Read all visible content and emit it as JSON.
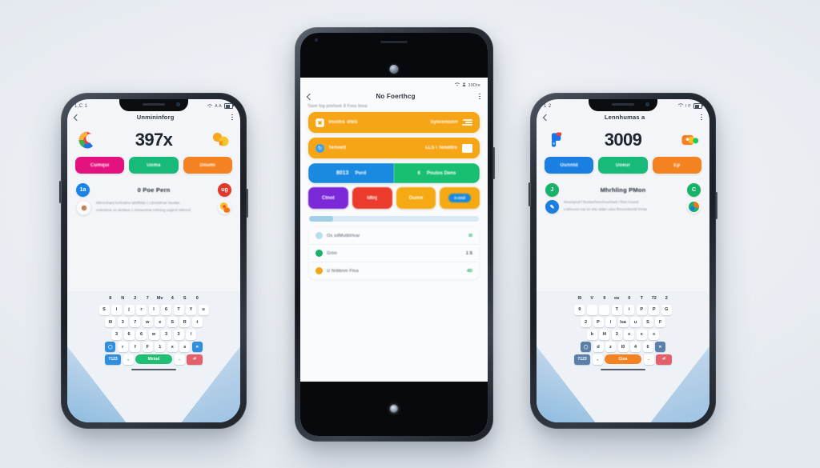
{
  "scene": {
    "background_color": "#eceff4",
    "description": "Three smartphones displayed side by side showing colorful mobile app screens"
  },
  "phones": [
    {
      "id": "left-phone",
      "frame_color": "#2a3039",
      "status_bar": {
        "left": "1,C 1",
        "wifi": "wifi-icon",
        "signal": "A A",
        "battery": "0"
      },
      "app_bar": {
        "back": "back-chevron-icon",
        "title": "Unmininforg",
        "menu": "kebab-menu-icon"
      },
      "hero": {
        "number": "397x",
        "left_glyph": "colorful-c-logo-icon",
        "right_glyph": "orange-cloud-icon"
      },
      "pills": [
        {
          "label": "Cumqui",
          "color": "#e3127f"
        },
        {
          "label": "Uoma",
          "color": "#17ba78"
        },
        {
          "label": "Doumi",
          "color": "#f58220"
        }
      ],
      "row": {
        "left_badge": "1a",
        "left_badge_color": "#1a84e8",
        "title": "0 Poe Pern",
        "right_badge": "ug",
        "right_badge_color": "#e0392b"
      },
      "description": {
        "line1": "Mthorolopul lunhodino tdmfbfab 1 Libontdroar haudan",
        "line2": "Anbnlazar uo denlaun 1 Aimaonima Anhning uoginol vldmnul",
        "left_icon": "avatar-icon",
        "right_icon": "orange-heart-icon"
      },
      "keyboard": {
        "number_row": [
          "8",
          "N",
          "2",
          "7",
          "Mv",
          "4",
          "S",
          "0"
        ],
        "row1": [
          "S",
          "i",
          "j",
          "r",
          "l",
          "6",
          "T",
          "Y",
          "u"
        ],
        "row2": [
          "l0",
          "3",
          "7",
          "w",
          "e",
          "S",
          "R",
          "t"
        ],
        "row3": [
          "3",
          "6",
          "6",
          "w",
          "3",
          "3",
          "/"
        ],
        "row4": [
          "r",
          "f",
          "F",
          "1",
          "x",
          "s"
        ],
        "space_label": "Mxtod",
        "space_color": "#21bf73",
        "left_accent_color": "#2f8ede",
        "right_accent_color": "#e4606a",
        "left_key": "globe-icon",
        "right_key": "delete-icon"
      }
    },
    {
      "id": "center-phone",
      "frame_color": "#1a1d22",
      "status_bar": {
        "wifi": "wifi-icon",
        "person": "person-icon",
        "battery_text": "39Dte"
      },
      "app_bar": {
        "back": "back-chevron-icon",
        "title": "No Foerthcg",
        "menu": "kebab-menu-icon"
      },
      "subline": "Tosm fog pmrlontr 8  Fons bnsa",
      "banners": [
        {
          "label": "Vooths dlbS",
          "right_text": "Synconozirr",
          "color": "#f5a515",
          "icon": "folder-icon",
          "right_icon": "stacked-lines-icon"
        },
        {
          "label": "Tenvett",
          "right_text": "LLS l Tenditro",
          "color": "#f5a515",
          "icon": "sync-circle-icon",
          "right_icon": "card-icon"
        }
      ],
      "duo": [
        {
          "left": "8013",
          "right": "Pord",
          "color": "#1a8ae0"
        },
        {
          "left": "6",
          "right": "Poulos Dens",
          "color": "#18bf71"
        }
      ],
      "quad": [
        {
          "label": "Ctnot",
          "color": "#7b28d8"
        },
        {
          "label": "Idtnj",
          "color": "#eb3b2c"
        },
        {
          "label": "Ounre",
          "color": "#f5a912"
        },
        {
          "label": "",
          "color": "#f5a912",
          "button_label": "n-ond",
          "button_color": "#1a8ae0"
        }
      ],
      "progress": {
        "value": 14,
        "track_color": "#d9eaf4",
        "fill_color": "#9fd0e8"
      },
      "list": [
        {
          "icon_color": "#b6e0ef",
          "label": "Os sdMutblrlvar",
          "value": "I0",
          "value_color": "#14a85f"
        },
        {
          "icon_color": "#19b26a",
          "label": "Grtm",
          "value": "1 S",
          "value_color": "#445060"
        },
        {
          "icon_color": "#f5a515",
          "label": "U Nrbbnm Floa",
          "value": "4D",
          "value_color": "#14a85f"
        }
      ]
    },
    {
      "id": "right-phone",
      "frame_color": "#262b33",
      "status_bar": {
        "left": "1 2",
        "wifi": "wifi-icon",
        "signal": "I P",
        "battery": "8 6"
      },
      "app_bar": {
        "back": "back-chevron-icon",
        "title": "Lennhumas a",
        "menu": "kebab-menu-icon"
      },
      "hero": {
        "number": "3009",
        "left_glyph": "blue-flag-icon",
        "right_glyph": "orange-wallet-icon"
      },
      "pills": [
        {
          "label": "Ounntd",
          "color": "#1a7fe0"
        },
        {
          "label": "Uoeur",
          "color": "#17ba78"
        },
        {
          "label": "Ep",
          "color": "#f58220"
        }
      ],
      "row": {
        "left_badge": "J",
        "left_badge_color": "#17b26a",
        "title": "Mhrhling PMon",
        "right_badge": "C",
        "right_badge_color": "#17b26a"
      },
      "description": {
        "line1": "Mounrjnvd f thurbarhmnchounharb l flont  Huond",
        "line2": "Lnbhouon rup tor nhu uldpn uduo fhnoombsmb hnnta",
        "left_icon": "blue-pen-icon",
        "right_icon": "pie-chart-icon"
      },
      "keyboard": {
        "number_row": [
          "l9",
          "V",
          "9",
          "os",
          "0",
          "T",
          "72",
          "2"
        ],
        "row1": [
          "9",
          "",
          "",
          "T",
          "i",
          "P",
          "P",
          "G"
        ],
        "row2": [
          "2",
          "P",
          "/",
          "lsa",
          "u",
          "S",
          "F"
        ],
        "row3": [
          "b",
          "l4",
          "3",
          "c",
          "c",
          "c"
        ],
        "row4": [
          "d",
          "z",
          "l0",
          "4",
          "6"
        ],
        "space_label": "Ctos",
        "space_color": "#f58220",
        "left_accent_color": "#5b7fa8",
        "right_accent_color": "#e4606a",
        "left_key": "globe-icon",
        "right_key": "delete-icon"
      }
    }
  ]
}
